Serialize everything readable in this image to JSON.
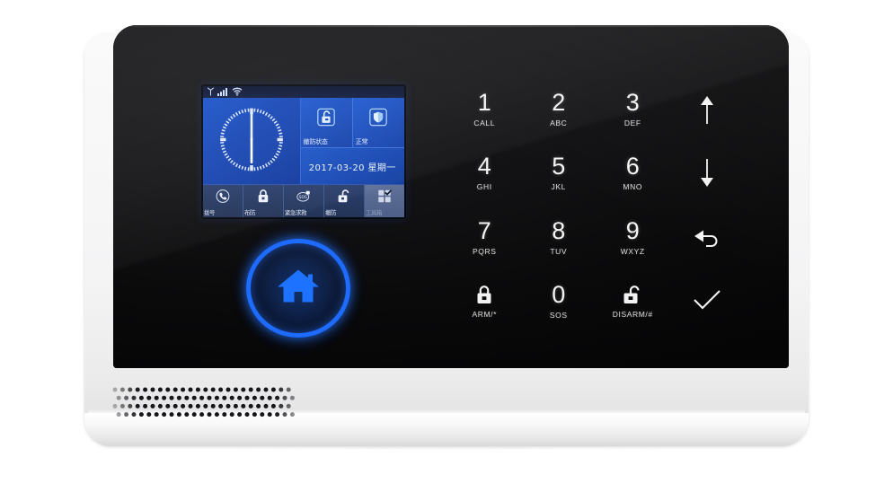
{
  "device": {
    "name": "wireless-alarm-panel",
    "colors": {
      "glass": "#0a0a0b",
      "body": "#f4f4f5",
      "accent_blue": "#1d6bff",
      "lcd_blue": "#1a53c9",
      "key_text": "#f2f2f2"
    }
  },
  "screen": {
    "statusbar": {
      "signal_icon": "cellular-signal-icon",
      "signal_bars": 4,
      "wifi_icon": "wifi-icon",
      "antenna_icon": "antenna-icon"
    },
    "clock": {
      "icon": "analog-clock-icon",
      "hour": 6,
      "minute": 0,
      "time_label": "6:00"
    },
    "tiles": [
      {
        "icon": "unlocked-padlock-icon",
        "label": "撤防状态"
      },
      {
        "icon": "shield-icon",
        "label": "正常"
      }
    ],
    "date": {
      "value": "2017-03-20 星期一"
    },
    "dock": [
      {
        "icon": "phone-handset-icon",
        "label": "拨号",
        "active": false
      },
      {
        "icon": "locked-padlock-icon",
        "label": "布防",
        "active": false
      },
      {
        "icon": "sos-icon",
        "label": "紧急求救",
        "active": false
      },
      {
        "icon": "unlocked-padlock-icon",
        "label": "撤防",
        "active": false
      },
      {
        "icon": "menu-grid-check-icon",
        "label": "工具箱",
        "active": true
      }
    ]
  },
  "home_button": {
    "icon": "home-icon",
    "label": "Home"
  },
  "keypad": {
    "keys": [
      {
        "digit": "1",
        "sub": "CALL",
        "name": "key-1-call",
        "type": "digit"
      },
      {
        "digit": "2",
        "sub": "ABC",
        "name": "key-2-abc",
        "type": "digit"
      },
      {
        "digit": "3",
        "sub": "DEF",
        "name": "key-3-def",
        "type": "digit"
      },
      {
        "digit": "",
        "sub": "",
        "name": "key-up-arrow",
        "type": "glyph",
        "icon": "arrow-up-icon"
      },
      {
        "digit": "4",
        "sub": "GHI",
        "name": "key-4-ghi",
        "type": "digit"
      },
      {
        "digit": "5",
        "sub": "JKL",
        "name": "key-5-jkl",
        "type": "digit"
      },
      {
        "digit": "6",
        "sub": "MNO",
        "name": "key-6-mno",
        "type": "digit"
      },
      {
        "digit": "",
        "sub": "",
        "name": "key-down-arrow",
        "type": "glyph",
        "icon": "arrow-down-icon"
      },
      {
        "digit": "7",
        "sub": "PQRS",
        "name": "key-7-pqrs",
        "type": "digit"
      },
      {
        "digit": "8",
        "sub": "TUV",
        "name": "key-8-tuv",
        "type": "digit"
      },
      {
        "digit": "9",
        "sub": "WXYZ",
        "name": "key-9-wxyz",
        "type": "digit"
      },
      {
        "digit": "",
        "sub": "",
        "name": "key-back",
        "type": "glyph",
        "icon": "back-arrow-icon"
      },
      {
        "digit": "",
        "sub": "ARM/*",
        "name": "key-arm",
        "type": "glyph",
        "icon": "locked-padlock-icon"
      },
      {
        "digit": "0",
        "sub": "SOS",
        "name": "key-0-sos",
        "type": "digit"
      },
      {
        "digit": "",
        "sub": "DISARM/#",
        "name": "key-disarm",
        "type": "glyph",
        "icon": "unlocked-padlock-icon"
      },
      {
        "digit": "",
        "sub": "",
        "name": "key-confirm",
        "type": "glyph",
        "icon": "checkmark-icon"
      }
    ]
  },
  "speaker": {
    "name": "speaker-grille",
    "rows": 4,
    "dots_per_row": 24
  }
}
